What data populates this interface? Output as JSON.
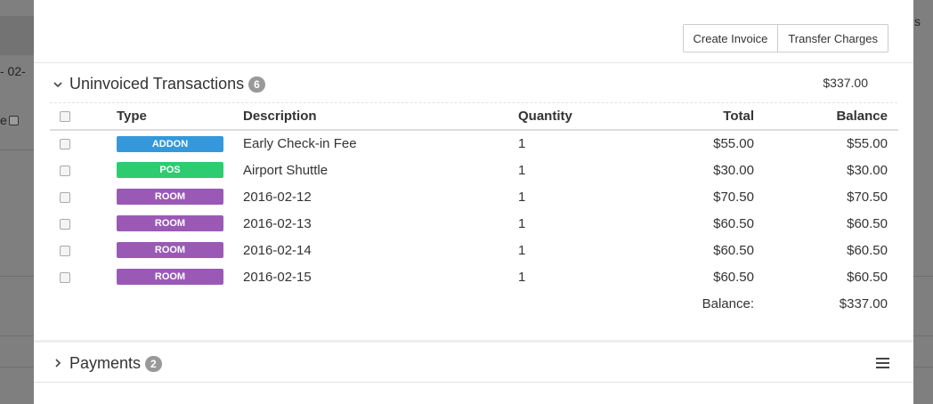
{
  "background": {
    "left_text_1": "- 02-",
    "left_text_2": "e",
    "right_text": "s"
  },
  "toolbar": {
    "create_invoice_label": "Create Invoice",
    "transfer_charges_label": "Transfer Charges"
  },
  "uninvoiced": {
    "title": "Uninvoiced Transactions",
    "count": "6",
    "total": "$337.00",
    "expanded": true,
    "columns": {
      "type": "Type",
      "description": "Description",
      "quantity": "Quantity",
      "total": "Total",
      "balance": "Balance"
    },
    "rows": [
      {
        "type": "ADDON",
        "type_color": "#3498db",
        "description": "Early Check-in Fee",
        "quantity": "1",
        "total": "$55.00",
        "balance": "$55.00"
      },
      {
        "type": "POS",
        "type_color": "#2ecc71",
        "description": "Airport Shuttle",
        "quantity": "1",
        "total": "$30.00",
        "balance": "$30.00"
      },
      {
        "type": "ROOM",
        "type_color": "#9b59b6",
        "description": "2016-02-12",
        "quantity": "1",
        "total": "$70.50",
        "balance": "$70.50"
      },
      {
        "type": "ROOM",
        "type_color": "#9b59b6",
        "description": "2016-02-13",
        "quantity": "1",
        "total": "$60.50",
        "balance": "$60.50"
      },
      {
        "type": "ROOM",
        "type_color": "#9b59b6",
        "description": "2016-02-14",
        "quantity": "1",
        "total": "$60.50",
        "balance": "$60.50"
      },
      {
        "type": "ROOM",
        "type_color": "#9b59b6",
        "description": "2016-02-15",
        "quantity": "1",
        "total": "$60.50",
        "balance": "$60.50"
      }
    ],
    "balance_label": "Balance:",
    "balance_value": "$337.00"
  },
  "payments": {
    "title": "Payments",
    "count": "2",
    "expanded": false,
    "menu_icon": "hamburger-menu-icon"
  }
}
